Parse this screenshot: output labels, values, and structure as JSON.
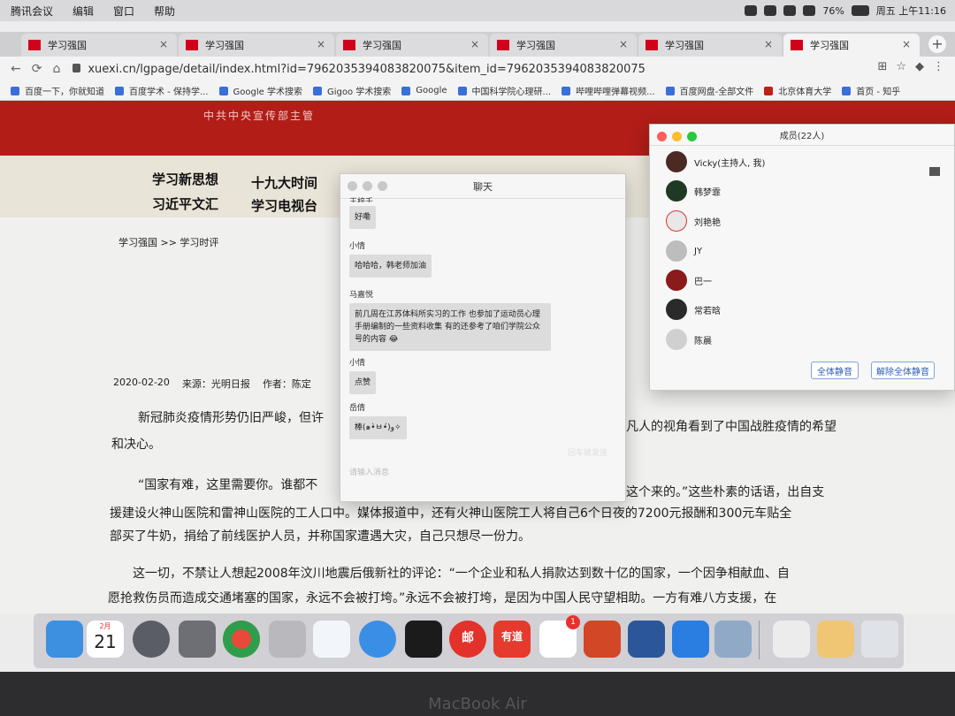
{
  "menubar": {
    "items": [
      "腾讯会议",
      "编辑",
      "窗口",
      "帮助"
    ],
    "battery": "76%",
    "clock": "周五 上午11:16"
  },
  "tabs": [
    {
      "title": "学习强国"
    },
    {
      "title": "学习强国"
    },
    {
      "title": "学习强国"
    },
    {
      "title": "学习强国"
    },
    {
      "title": "学习强国"
    },
    {
      "title": "学习强国"
    }
  ],
  "address": {
    "url": "xuexi.cn/lgpage/detail/index.html?id=7962035394083820075&item_id=7962035394083820075"
  },
  "bookmarks": [
    "百度一下，你就知道",
    "百度学术 - 保持学...",
    "Google 学术搜索",
    "Gigoo 学术搜索",
    "Google",
    "中国科学院心理研...",
    "哔哩哔哩弹幕视频...",
    "百度网盘-全部文件",
    "北京体育大学",
    "首页 - 知乎"
  ],
  "page": {
    "banner_sub": "中共中央宣传部主管",
    "nav": [
      "学习新思想",
      "十九大时间",
      "习近平文汇",
      "学习电视台"
    ],
    "breadcrumb": "学习强国 >> 学习时评",
    "date": "2020-02-20",
    "source": "来源：光明日报",
    "author": "作者：陈定",
    "p1a": "新冠肺炎疫情形势仍旧严峻，但许",
    "p1b": "凡人的视角看到了中国战胜疫情的希望",
    "p1c": "和决心。",
    "p2a": "“国家有难，这里需要你。谁都不",
    "p2b": "这个来的。”这些朴素的话语，出自支",
    "p2c": "援建设火神山医院和雷神山医院的工人口中。媒体报道中，还有火神山医院工人将自己6个日夜的7200元报酬和300元车贴全",
    "p2d": "部买了牛奶，捐给了前线医护人员，并称国家遭遇大灾，自己只想尽一份力。",
    "p3a": "这一切，不禁让人想起2008年汶川地震后俄新社的评论：“一个企业和私人捐款达到数十亿的国家，一个因争相献血、自",
    "p3b": "愿抢救伤员而造成交通堵塞的国家，永远不会被打垮。”永远不会被打垮，是因为中国人民守望相助。一方有难八方支援，在"
  },
  "chat": {
    "title": "聊天",
    "messages": [
      {
        "sender": "王梓千",
        "text": "好嘞"
      },
      {
        "sender": "小情",
        "text": "哈哈哈，韩老师加油"
      },
      {
        "sender": "马嘉悦",
        "text": "前几周在江苏体科所实习的工作 也参加了运动员心理手册编制的一些资料收集 有的还参考了咱们学院公众号的内容 😂"
      },
      {
        "sender": "小情",
        "text": "点赞"
      },
      {
        "sender": "岳倩",
        "text": "棒(๑•̀ㅂ•́)و✧"
      }
    ],
    "send_label": "回车键发送",
    "input_placeholder": "请输入消息"
  },
  "members": {
    "title": "成员(22人)",
    "list": [
      {
        "name": "Vicky(主持人, 我)",
        "color": "#4a2a22"
      },
      {
        "name": "韩梦霏",
        "color": "#1f3a24"
      },
      {
        "name": "刘艳艳",
        "color": "#e8e8e8"
      },
      {
        "name": "JY",
        "color": "#bdbdbd"
      },
      {
        "name": "巴一",
        "color": "#8b1a1a"
      },
      {
        "name": "常若晗",
        "color": "#2a2a2a"
      },
      {
        "name": "陈晨",
        "color": "#d0d0d0"
      }
    ],
    "mute_all": "全体静音",
    "unmute_all": "解除全体静音"
  },
  "dock": {
    "calendar_month": "2月",
    "calendar_day": "21",
    "mail_label": "邮",
    "youdao_label": "有道",
    "wechat_badge": "1"
  },
  "bezel_label": "MacBook Air"
}
